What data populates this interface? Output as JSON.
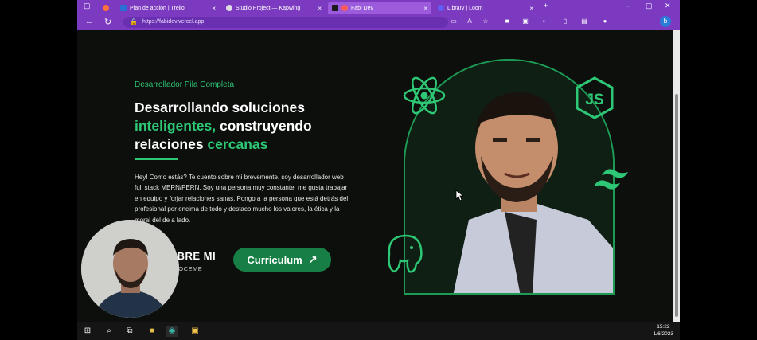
{
  "browser": {
    "tabs": [
      {
        "title": "Plan de acción | Trello",
        "color": "#2a6fd6"
      },
      {
        "title": "Studio Project — Kapwing",
        "color": "#ffffff"
      },
      {
        "title": "Fabi Dev",
        "color": "#ff5a5a"
      },
      {
        "title": "Library | Loom",
        "color": "#625df5"
      }
    ],
    "url": "https://fabidev.vercel.app"
  },
  "hero": {
    "eyebrow": "Desarrollador Pila Completa",
    "headline": {
      "line1": "Desarrollando soluciones",
      "hl1": "inteligentes,",
      "mid": " construyendo",
      "line3_a": "relaciones ",
      "hl2": "cercanas"
    },
    "intro": "Hey! Como estás? Te cuento sobre mi brevemente, soy desarrollador web full stack MERN/PERN. Soy una persona muy constante, me gusta trabajar en equipo y forjar relaciones sanas. Pongo a la persona que está detrás del profesional por encima de todo y destaco mucho los valores, la ética y la moral del de a lado.",
    "about_title": "OBRE MI",
    "about_sub": "ONOCEME",
    "cv_label": "Curriculum",
    "cv_arrow": "↗"
  },
  "icons": [
    "react-icon",
    "nodejs-icon",
    "tailwind-icon",
    "postgresql-icon"
  ],
  "taskbar": {
    "time": "15:22",
    "date": "1/6/2023"
  },
  "colors": {
    "accent": "#2ec775",
    "browser": "#7b3ac0",
    "background": "#0c0f0c"
  }
}
